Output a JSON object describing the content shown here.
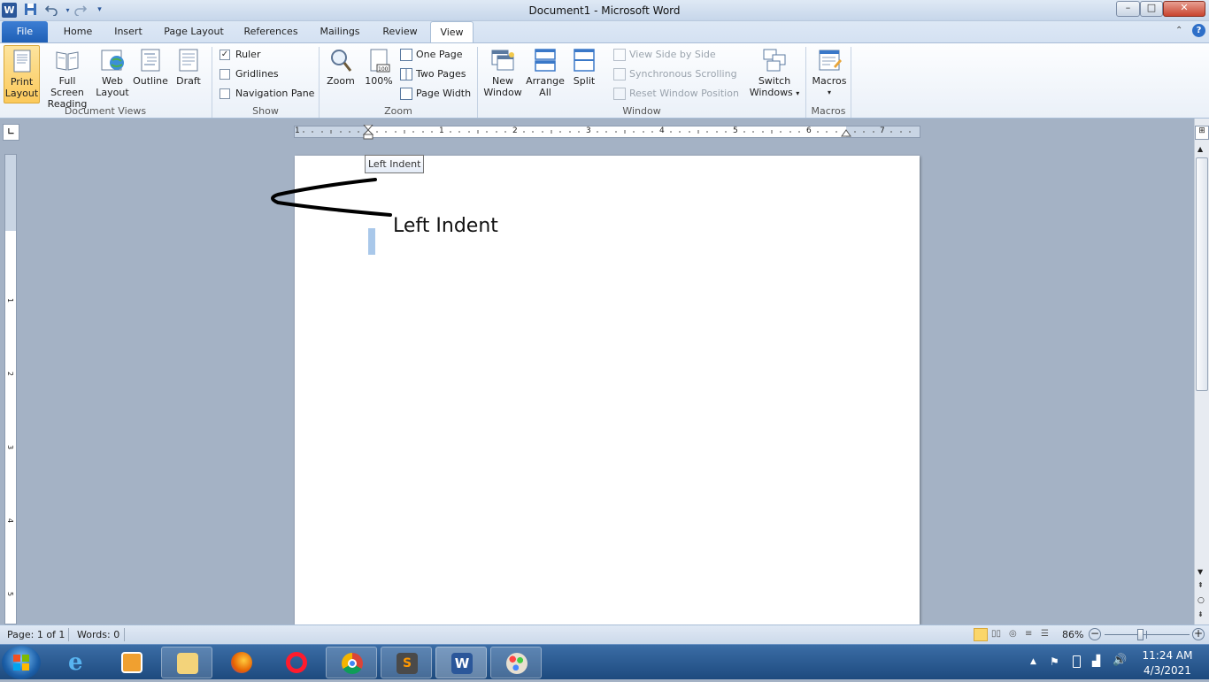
{
  "window": {
    "title": "Document1 - Microsoft Word",
    "controls": {
      "minimize": "–",
      "maximize": "□",
      "close": "✕"
    }
  },
  "quick_access": {
    "app_icon": "W",
    "save_icon": "save-icon",
    "undo_icon": "undo-icon",
    "redo_icon": "redo-icon"
  },
  "tabs": [
    "File",
    "Home",
    "Insert",
    "Page Layout",
    "References",
    "Mailings",
    "Review",
    "View"
  ],
  "active_tab": "View",
  "ribbon": {
    "document_views": {
      "label": "Document Views",
      "print_layout": [
        "Print",
        "Layout"
      ],
      "full_screen": [
        "Full Screen",
        "Reading"
      ],
      "web_layout": [
        "Web",
        "Layout"
      ],
      "outline": "Outline",
      "draft": "Draft"
    },
    "show": {
      "label": "Show",
      "ruler": "Ruler",
      "ruler_checked": true,
      "gridlines": "Gridlines",
      "navigation_pane": "Navigation Pane"
    },
    "zoom": {
      "label": "Zoom",
      "zoom": "Zoom",
      "hundred": "100%",
      "one_page": "One Page",
      "two_pages": "Two Pages",
      "page_width": "Page Width"
    },
    "window": {
      "label": "Window",
      "new_window": [
        "New",
        "Window"
      ],
      "arrange_all": [
        "Arrange",
        "All"
      ],
      "split": "Split",
      "view_side_by_side": "View Side by Side",
      "sync_scrolling": "Synchronous Scrolling",
      "reset_position": "Reset Window Position",
      "switch_windows": [
        "Switch",
        "Windows"
      ]
    },
    "macros": {
      "label": "Macros",
      "macros": "Macros"
    }
  },
  "ruler_numbers": [
    "1",
    "1",
    "2",
    "3",
    "4",
    "5",
    "6",
    "7"
  ],
  "vruler_numbers": [
    "1",
    "2",
    "3",
    "4",
    "5"
  ],
  "tooltip": "Left Indent",
  "document": {
    "text": "Left Indent"
  },
  "status": {
    "page": "Page: 1 of 1",
    "words": "Words: 0",
    "zoom": "86%",
    "zoom_level": 0.86
  },
  "taskbar": {
    "time": "11:24 AM",
    "date": "4/3/2021",
    "apps": [
      "internet-explorer-icon",
      "media-player-icon",
      "file-explorer-icon",
      "firefox-icon",
      "opera-icon",
      "chrome-icon",
      "sublime-text-icon",
      "word-icon",
      "paint-icon"
    ]
  },
  "colors": {
    "accent": "#2b579a",
    "file_tab": "#1f5fb5",
    "selected": "#fbc95b"
  }
}
